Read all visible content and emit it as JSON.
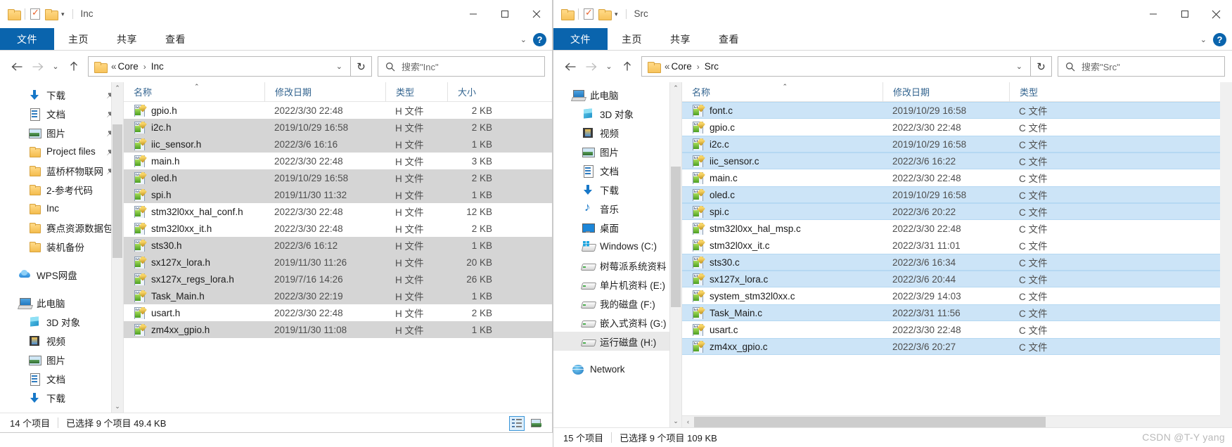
{
  "left_window": {
    "title": "Inc",
    "quick_access": {
      "folder_icon": "folder-icon",
      "properties_icon": "properties-checkbox-icon",
      "new_folder_icon": "new-folder-icon",
      "customize_icon": "chevron-down-icon"
    },
    "window_controls": {
      "minimize": "minimize-icon",
      "maximize": "maximize-icon",
      "close": "close-icon"
    },
    "ribbon_tabs": [
      {
        "label": "文件",
        "active": true
      },
      {
        "label": "主页",
        "active": false
      },
      {
        "label": "共享",
        "active": false
      },
      {
        "label": "查看",
        "active": false
      }
    ],
    "ribbon_right": {
      "collapse_icon": "chevron-down-icon",
      "help_icon": "help-icon",
      "help_label": "?"
    },
    "nav": {
      "back_icon": "arrow-left-icon",
      "forward_icon": "arrow-right-icon",
      "recent_icon": "chevron-down-icon",
      "up_icon": "arrow-up-icon",
      "breadcrumb": {
        "overflow": "«",
        "parts": [
          "Core",
          "Inc"
        ],
        "separator": "›"
      },
      "dropdown_icon": "chevron-down-icon",
      "refresh_icon": "refresh-icon"
    },
    "search": {
      "placeholder": "搜索\"Inc\"",
      "icon": "search-icon"
    },
    "sidebar": [
      {
        "label": "下载",
        "icon": "download-icon",
        "level": 1,
        "pinned": true
      },
      {
        "label": "文档",
        "icon": "document-icon",
        "level": 1,
        "pinned": true
      },
      {
        "label": "图片",
        "icon": "picture-icon",
        "level": 1,
        "pinned": true
      },
      {
        "label": "Project files",
        "icon": "folder-icon",
        "level": 1,
        "pinned": true
      },
      {
        "label": "蓝桥杯物联网",
        "icon": "folder-icon",
        "level": 1,
        "pinned": true
      },
      {
        "label": "2-参考代码",
        "icon": "folder-icon",
        "level": 1,
        "pinned": false
      },
      {
        "label": "Inc",
        "icon": "folder-icon",
        "level": 1,
        "pinned": false
      },
      {
        "label": "赛点资源数据包_",
        "icon": "folder-icon",
        "level": 1,
        "pinned": false
      },
      {
        "label": "装机备份",
        "icon": "folder-icon",
        "level": 1,
        "pinned": false
      },
      {
        "gap": true
      },
      {
        "label": "WPS网盘",
        "icon": "cloud-icon",
        "level": 0,
        "pinned": false
      },
      {
        "gap": true
      },
      {
        "label": "此电脑",
        "icon": "pc-icon",
        "level": 0,
        "pinned": false
      },
      {
        "label": "3D 对象",
        "icon": "3d-objects-icon",
        "level": 1,
        "pinned": false
      },
      {
        "label": "视频",
        "icon": "video-icon",
        "level": 1,
        "pinned": false
      },
      {
        "label": "图片",
        "icon": "picture-icon",
        "level": 1,
        "pinned": false
      },
      {
        "label": "文档",
        "icon": "document-icon",
        "level": 1,
        "pinned": false
      },
      {
        "label": "下载",
        "icon": "download-icon",
        "level": 1,
        "pinned": false
      }
    ],
    "columns": [
      "名称",
      "修改日期",
      "类型",
      "大小"
    ],
    "sort_column": "名称",
    "sort_icon": "sort-ascending-icon",
    "files": [
      {
        "name": "gpio.h",
        "date": "2022/3/30 22:48",
        "type": "H 文件",
        "size": "2 KB",
        "selected": false
      },
      {
        "name": "i2c.h",
        "date": "2019/10/29 16:58",
        "type": "H 文件",
        "size": "2 KB",
        "selected": true
      },
      {
        "name": "iic_sensor.h",
        "date": "2022/3/6 16:16",
        "type": "H 文件",
        "size": "1 KB",
        "selected": true
      },
      {
        "name": "main.h",
        "date": "2022/3/30 22:48",
        "type": "H 文件",
        "size": "3 KB",
        "selected": false
      },
      {
        "name": "oled.h",
        "date": "2019/10/29 16:58",
        "type": "H 文件",
        "size": "2 KB",
        "selected": true
      },
      {
        "name": "spi.h",
        "date": "2019/11/30 11:32",
        "type": "H 文件",
        "size": "1 KB",
        "selected": true
      },
      {
        "name": "stm32l0xx_hal_conf.h",
        "date": "2022/3/30 22:48",
        "type": "H 文件",
        "size": "12 KB",
        "selected": false
      },
      {
        "name": "stm32l0xx_it.h",
        "date": "2022/3/30 22:48",
        "type": "H 文件",
        "size": "2 KB",
        "selected": false
      },
      {
        "name": "sts30.h",
        "date": "2022/3/6 16:12",
        "type": "H 文件",
        "size": "1 KB",
        "selected": true
      },
      {
        "name": "sx127x_lora.h",
        "date": "2019/11/30 11:26",
        "type": "H 文件",
        "size": "20 KB",
        "selected": true
      },
      {
        "name": "sx127x_regs_lora.h",
        "date": "2019/7/16 14:26",
        "type": "H 文件",
        "size": "26 KB",
        "selected": true
      },
      {
        "name": "Task_Main.h",
        "date": "2022/3/30 22:19",
        "type": "H 文件",
        "size": "1 KB",
        "selected": true
      },
      {
        "name": "usart.h",
        "date": "2022/3/30 22:48",
        "type": "H 文件",
        "size": "2 KB",
        "selected": false
      },
      {
        "name": "zm4xx_gpio.h",
        "date": "2019/11/30 11:08",
        "type": "H 文件",
        "size": "1 KB",
        "selected": true
      }
    ],
    "status": {
      "count": "14 个项目",
      "selection": "已选择 9 个项目  49.4 KB"
    },
    "view_buttons": {
      "details": "details-view-icon",
      "large_icons": "large-icons-view-icon",
      "active": "details"
    }
  },
  "right_window": {
    "title": "Src",
    "quick_access": {
      "folder_icon": "folder-icon",
      "properties_icon": "properties-checkbox-icon",
      "new_folder_icon": "new-folder-icon",
      "customize_icon": "chevron-down-icon"
    },
    "window_controls": {
      "minimize": "minimize-icon",
      "maximize": "maximize-icon",
      "close": "close-icon"
    },
    "ribbon_tabs": [
      {
        "label": "文件",
        "active": true
      },
      {
        "label": "主页",
        "active": false
      },
      {
        "label": "共享",
        "active": false
      },
      {
        "label": "查看",
        "active": false
      }
    ],
    "ribbon_right": {
      "collapse_icon": "chevron-down-icon",
      "help_icon": "help-icon",
      "help_label": "?"
    },
    "nav": {
      "back_icon": "arrow-left-icon",
      "forward_icon": "arrow-right-icon",
      "recent_icon": "chevron-down-icon",
      "up_icon": "arrow-up-icon",
      "breadcrumb": {
        "overflow": "«",
        "parts": [
          "Core",
          "Src"
        ],
        "separator": "›"
      },
      "dropdown_icon": "chevron-down-icon",
      "refresh_icon": "refresh-icon"
    },
    "search": {
      "placeholder": "搜索\"Src\"",
      "icon": "search-icon"
    },
    "sidebar": [
      {
        "label": "此电脑",
        "icon": "pc-icon",
        "level": 0,
        "pinned": false
      },
      {
        "label": "3D 对象",
        "icon": "3d-objects-icon",
        "level": 1,
        "pinned": false
      },
      {
        "label": "视频",
        "icon": "video-icon",
        "level": 1,
        "pinned": false
      },
      {
        "label": "图片",
        "icon": "picture-icon",
        "level": 1,
        "pinned": false
      },
      {
        "label": "文档",
        "icon": "document-icon",
        "level": 1,
        "pinned": false
      },
      {
        "label": "下载",
        "icon": "download-icon",
        "level": 1,
        "pinned": false
      },
      {
        "label": "音乐",
        "icon": "music-icon",
        "level": 1,
        "pinned": false
      },
      {
        "label": "桌面",
        "icon": "desktop-icon",
        "level": 1,
        "pinned": false
      },
      {
        "label": "Windows (C:)",
        "icon": "windows-drive-icon",
        "level": 1,
        "pinned": false
      },
      {
        "label": "树莓派系统资料",
        "icon": "drive-icon",
        "level": 1,
        "pinned": false
      },
      {
        "label": "单片机资料 (E:)",
        "icon": "drive-icon",
        "level": 1,
        "pinned": false
      },
      {
        "label": "我的磁盘 (F:)",
        "icon": "drive-icon",
        "level": 1,
        "pinned": false
      },
      {
        "label": "嵌入式资料 (G:)",
        "icon": "drive-icon",
        "level": 1,
        "pinned": false
      },
      {
        "label": "运行磁盘 (H:)",
        "icon": "drive-icon",
        "level": 1,
        "pinned": false,
        "selected": true
      },
      {
        "gap": true
      },
      {
        "label": "Network",
        "icon": "network-icon",
        "level": 0,
        "pinned": false
      }
    ],
    "columns": [
      "名称",
      "修改日期",
      "类型"
    ],
    "sort_column": "名称",
    "sort_icon": "sort-ascending-icon",
    "files": [
      {
        "name": "font.c",
        "date": "2019/10/29 16:58",
        "type": "C 文件",
        "selected": true
      },
      {
        "name": "gpio.c",
        "date": "2022/3/30 22:48",
        "type": "C 文件",
        "selected": false
      },
      {
        "name": "i2c.c",
        "date": "2019/10/29 16:58",
        "type": "C 文件",
        "selected": true
      },
      {
        "name": "iic_sensor.c",
        "date": "2022/3/6 16:22",
        "type": "C 文件",
        "selected": true
      },
      {
        "name": "main.c",
        "date": "2022/3/30 22:48",
        "type": "C 文件",
        "selected": false
      },
      {
        "name": "oled.c",
        "date": "2019/10/29 16:58",
        "type": "C 文件",
        "selected": true
      },
      {
        "name": "spi.c",
        "date": "2022/3/6 20:22",
        "type": "C 文件",
        "selected": true
      },
      {
        "name": "stm32l0xx_hal_msp.c",
        "date": "2022/3/30 22:48",
        "type": "C 文件",
        "selected": false
      },
      {
        "name": "stm32l0xx_it.c",
        "date": "2022/3/31 11:01",
        "type": "C 文件",
        "selected": false
      },
      {
        "name": "sts30.c",
        "date": "2022/3/6 16:34",
        "type": "C 文件",
        "selected": true
      },
      {
        "name": "sx127x_lora.c",
        "date": "2022/3/6 20:44",
        "type": "C 文件",
        "selected": true
      },
      {
        "name": "system_stm32l0xx.c",
        "date": "2022/3/29 14:03",
        "type": "C 文件",
        "selected": false
      },
      {
        "name": "Task_Main.c",
        "date": "2022/3/31 11:56",
        "type": "C 文件",
        "selected": true
      },
      {
        "name": "usart.c",
        "date": "2022/3/30 22:48",
        "type": "C 文件",
        "selected": false
      },
      {
        "name": "zm4xx_gpio.c",
        "date": "2022/3/6 20:27",
        "type": "C 文件",
        "selected": true
      }
    ],
    "status": {
      "count": "15 个项目",
      "selection": "已选择 9 个项目  109 KB"
    },
    "view_buttons": {
      "details": "details-view-icon",
      "large_icons": "large-icons-view-icon",
      "active": "details"
    }
  },
  "watermark": "CSDN @T-Y yang",
  "colors": {
    "accent": "#0a64ad",
    "selection_active": "#cce4f7",
    "selection_inactive": "#d5d5d5",
    "header_text": "#33648f",
    "watermark": "#b9b9b9"
  }
}
